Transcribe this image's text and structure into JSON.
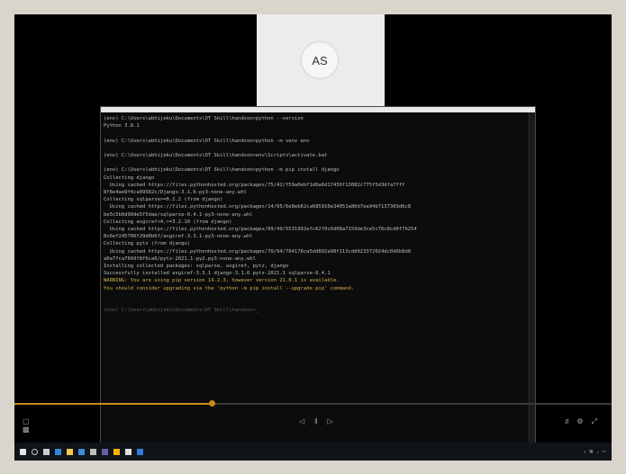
{
  "avatar": {
    "initials": "AS"
  },
  "terminal": {
    "lines": [
      {
        "text": "(env) C:\\Users\\abhijeku\\Documents\\DT Skill\\handson>python --version",
        "kind": "normal"
      },
      {
        "text": "Python 3.8.1",
        "kind": "normal"
      },
      {
        "text": "",
        "kind": "normal"
      },
      {
        "text": "(env) C:\\Users\\abhijeku\\Documents\\DT Skill\\handson>python -m venv env",
        "kind": "normal"
      },
      {
        "text": "",
        "kind": "normal"
      },
      {
        "text": "(env) C:\\Users\\abhijeku\\Documents\\DT Skill\\handson>env\\Scripts\\activate.bat",
        "kind": "normal"
      },
      {
        "text": "",
        "kind": "normal"
      },
      {
        "text": "(env) C:\\Users\\abhijeku\\Documents\\DT Skill\\handson>python -m pip install django",
        "kind": "normal"
      },
      {
        "text": "Collecting django",
        "kind": "normal"
      },
      {
        "text": "  Using cached https://files.pythonhosted.org/packages/75/42/f59a0ebf1d6a6d17430f13082c775f5d3dfa7fff",
        "kind": "normal"
      },
      {
        "text": "8f8e4ae9f4ca09582c/Django-3.1.6-py3-none-any.whl",
        "kind": "normal"
      },
      {
        "text": "Collecting sqlparse>=0.2.2 (from django)",
        "kind": "normal"
      },
      {
        "text": "  Using cached https://files.pythonhosted.org/packages/14/05/6e8eb62ca685910e34051a80d7ea94b7137369d6c8",
        "kind": "normal"
      },
      {
        "text": "be5c5b6d90de5f5dae/sqlparse-0.4.1-py3-none-any.whl",
        "kind": "normal"
      },
      {
        "text": "Collecting asgiref<4,>=3.2.10 (from django)",
        "kind": "normal"
      },
      {
        "text": "  Using cached https://files.pythonhosted.org/packages/89/49/5531992efc62f9c6d08a7159de3ce5c76c8cd0f7b254",
        "kind": "normal"
      },
      {
        "text": "8c6ef245706f29d0b6f/asgiref-3.3.1-py3-none-any.whl",
        "kind": "normal"
      },
      {
        "text": "Collecting pytz (from django)",
        "kind": "normal"
      },
      {
        "text": "  Using cached https://files.pythonhosted.org/packages/70/94/784178ca5dd892a98f113cdd923372024dc0d6b8d0",
        "kind": "normal"
      },
      {
        "text": "a0a7fca7660f8f6ca6/pytz-2021.1-py2.py3-none-any.whl",
        "kind": "normal"
      },
      {
        "text": "Installing collected packages: sqlparse, asgiref, pytz, django",
        "kind": "normal"
      },
      {
        "text": "Successfully installed asgiref-3.3.1 django-3.1.6 pytz-2021.1 sqlparse-0.4.1",
        "kind": "normal"
      },
      {
        "text": "WARNING: You are using pip version 19.2.3, however version 21.0.1 is available.",
        "kind": "warn"
      },
      {
        "text": "You should consider upgrading via the 'python -m pip install --upgrade pip' command.",
        "kind": "warn"
      },
      {
        "text": "",
        "kind": "normal"
      },
      {
        "text": "",
        "kind": "normal"
      },
      {
        "text": "(env) C:\\Users\\abhijeku\\Documents\\DT Skill\\handson>_",
        "kind": "prompt-dim"
      }
    ]
  },
  "player": {
    "progress_fraction": 0.33,
    "left_icons": [
      "window-icon",
      "screen-icon"
    ],
    "center_icons": [
      "rewind-icon",
      "pause-icon",
      "forward-icon"
    ],
    "right_icons": [
      "volume-icon",
      "settings-icon",
      "fullscreen-icon"
    ]
  },
  "taskbar": {
    "icons": [
      "windows-start-icon",
      "search-icon",
      "task-view-icon",
      "edge-icon",
      "explorer-icon",
      "mail-icon",
      "store-icon",
      "teams-icon",
      "chrome-icon",
      "terminal-icon",
      "app-icon"
    ],
    "tray_icons": [
      "chevron-up-icon",
      "network-icon",
      "volume-icon",
      "battery-icon"
    ],
    "colors": {
      "windows-start-icon": "#e6e6e6",
      "search-icon": "#cfcfcf",
      "task-view-icon": "#cfcfcf",
      "edge-icon": "#2b88d8",
      "explorer-icon": "#f2c94c",
      "mail-icon": "#3c8cd9",
      "store-icon": "#bfbfbf",
      "teams-icon": "#6264a7",
      "chrome-icon": "#f4b400",
      "terminal-icon": "#e0e0e0",
      "app-icon": "#2d7de0"
    }
  }
}
